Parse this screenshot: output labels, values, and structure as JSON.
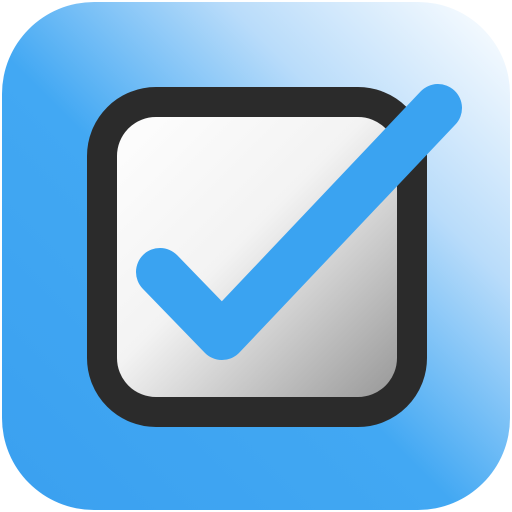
{
  "icon": {
    "semantic": "checkbox-checked-app-icon",
    "colors": {
      "tile_light": "#ffffff",
      "tile_mid": "#b9dcfa",
      "tile_blue": "#42a8f3",
      "tile_blue_deep": "#3aa0f0",
      "box_stroke": "#2b2b2b",
      "box_fill_light": "#ffffff",
      "box_fill_dark": "#8f8f8f",
      "check_mark": "#3aa3f1"
    }
  }
}
